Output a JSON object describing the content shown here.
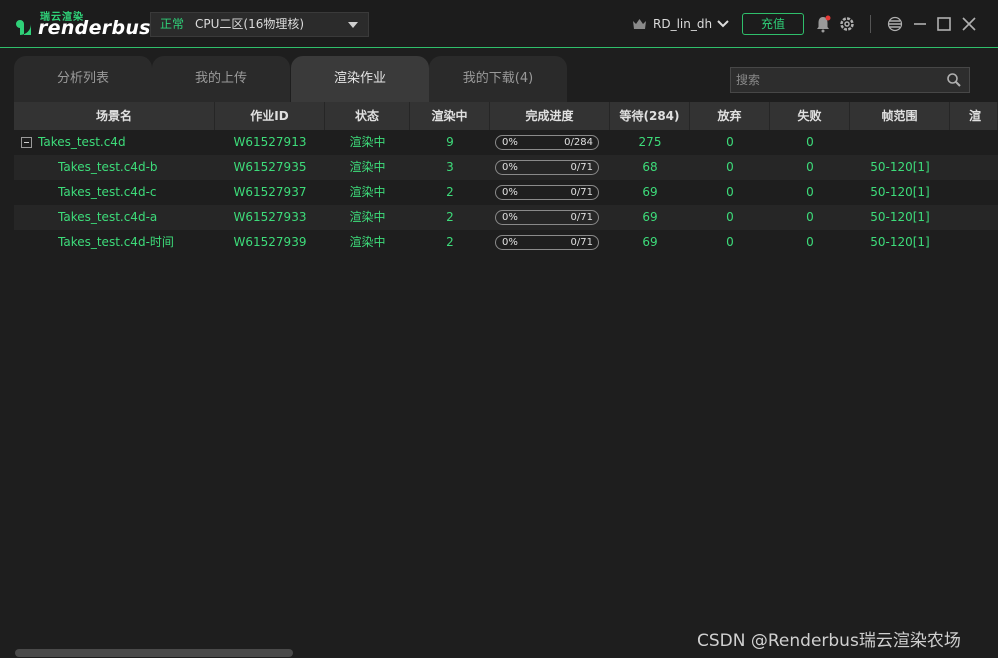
{
  "app": {
    "logo_cn": "瑞云渲染",
    "logo_en": "renderbus",
    "mode_status": "正常",
    "mode_label": "CPU二区(16物理核)",
    "user_name": "RD_lin_dh",
    "recharge_label": "充值",
    "accent": "#2fd078"
  },
  "tabs": [
    {
      "label": "分析列表"
    },
    {
      "label": "我的上传"
    },
    {
      "label": "渲染作业",
      "active": true
    },
    {
      "label": "我的下载(4)"
    }
  ],
  "search": {
    "placeholder": "搜索"
  },
  "table": {
    "headers": [
      "场景名",
      "作业ID",
      "状态",
      "渲染中",
      "完成进度",
      "等待(284)",
      "放弃",
      "失败",
      "帧范围",
      "渲"
    ],
    "rows": [
      {
        "name": "Takes_test.c4d",
        "id": "W61527913",
        "status": "渲染中",
        "rendering": "9",
        "pct": "0%",
        "count": "0/284",
        "progress": 0,
        "waiting": "275",
        "abandon": "0",
        "failed": "0",
        "frames": "",
        "parent": true
      },
      {
        "name": "Takes_test.c4d-b",
        "id": "W61527935",
        "status": "渲染中",
        "rendering": "3",
        "pct": "0%",
        "count": "0/71",
        "progress": 0,
        "waiting": "68",
        "abandon": "0",
        "failed": "0",
        "frames": "50-120[1]"
      },
      {
        "name": "Takes_test.c4d-c",
        "id": "W61527937",
        "status": "渲染中",
        "rendering": "2",
        "pct": "0%",
        "count": "0/71",
        "progress": 0,
        "waiting": "69",
        "abandon": "0",
        "failed": "0",
        "frames": "50-120[1]"
      },
      {
        "name": "Takes_test.c4d-a",
        "id": "W61527933",
        "status": "渲染中",
        "rendering": "2",
        "pct": "0%",
        "count": "0/71",
        "progress": 0,
        "waiting": "69",
        "abandon": "0",
        "failed": "0",
        "frames": "50-120[1]"
      },
      {
        "name": "Takes_test.c4d-时间",
        "id": "W61527939",
        "status": "渲染中",
        "rendering": "2",
        "pct": "0%",
        "count": "0/71",
        "progress": 0,
        "waiting": "69",
        "abandon": "0",
        "failed": "0",
        "frames": "50-120[1]"
      }
    ]
  },
  "watermark": "CSDN @Renderbus瑞云渲染农场"
}
